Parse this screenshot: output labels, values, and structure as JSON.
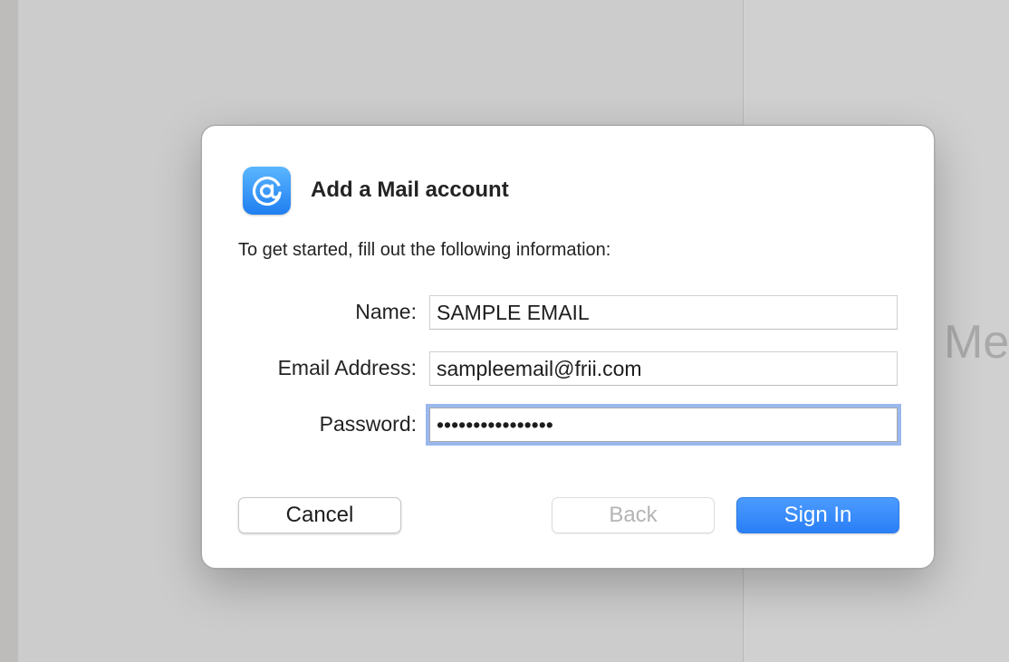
{
  "background": {
    "placeholder_text": "Me"
  },
  "dialog": {
    "title": "Add a Mail account",
    "intro": "To get started, fill out the following information:",
    "icon": "at-sign-icon",
    "accent_color": "#2a7ff6",
    "fields": {
      "name": {
        "label": "Name:",
        "value": "SAMPLE EMAIL"
      },
      "email": {
        "label": "Email Address:",
        "value": "sampleemail@frii.com"
      },
      "password": {
        "label": "Password:",
        "value": "••••••••••••••••"
      }
    },
    "buttons": {
      "cancel": "Cancel",
      "back": "Back",
      "sign_in": "Sign In"
    }
  }
}
